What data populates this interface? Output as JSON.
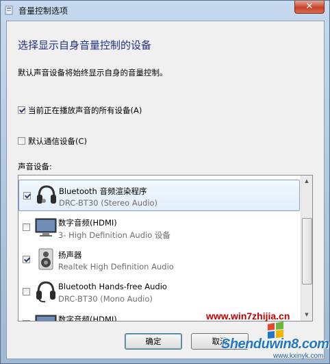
{
  "window": {
    "title": "音量控制选项",
    "close_symbol": "✕"
  },
  "heading": "选择显示自身音量控制的设备",
  "description": "默认声音设备将始终显示自身的音量控制。",
  "options": [
    {
      "label": "当前正在播放声音的所有设备(A)",
      "checked": true
    },
    {
      "label": "默认通信设备(C)",
      "checked": false
    }
  ],
  "devices_label": "声音设备:",
  "devices": [
    {
      "name": "Bluetooth 音频渲染程序",
      "sub": "DRC-BT30 (Stereo Audio)",
      "checked": true,
      "selected": true,
      "icon": "headset-icon"
    },
    {
      "name": "数字音频(HDMI)",
      "sub": "3- High Definition Audio 设备",
      "checked": false,
      "selected": false,
      "icon": "monitor-icon"
    },
    {
      "name": "扬声器",
      "sub": "Realtek High Definition Audio",
      "checked": true,
      "selected": false,
      "icon": "speaker-icon"
    },
    {
      "name": "Bluetooth Hands-free Audio",
      "sub": "DRC-BT30 (Mono Audio)",
      "checked": false,
      "selected": false,
      "icon": "headset-icon"
    },
    {
      "name": "数字音频(HDMI)",
      "sub": "",
      "checked": false,
      "selected": false,
      "icon": "monitor-icon"
    }
  ],
  "buttons": {
    "ok": "确定",
    "cancel": "取消"
  },
  "watermark": {
    "url": "www.win7zhijia.cn",
    "site": "Shenduwin8.com",
    "sub": "www.kxinyk.com"
  }
}
